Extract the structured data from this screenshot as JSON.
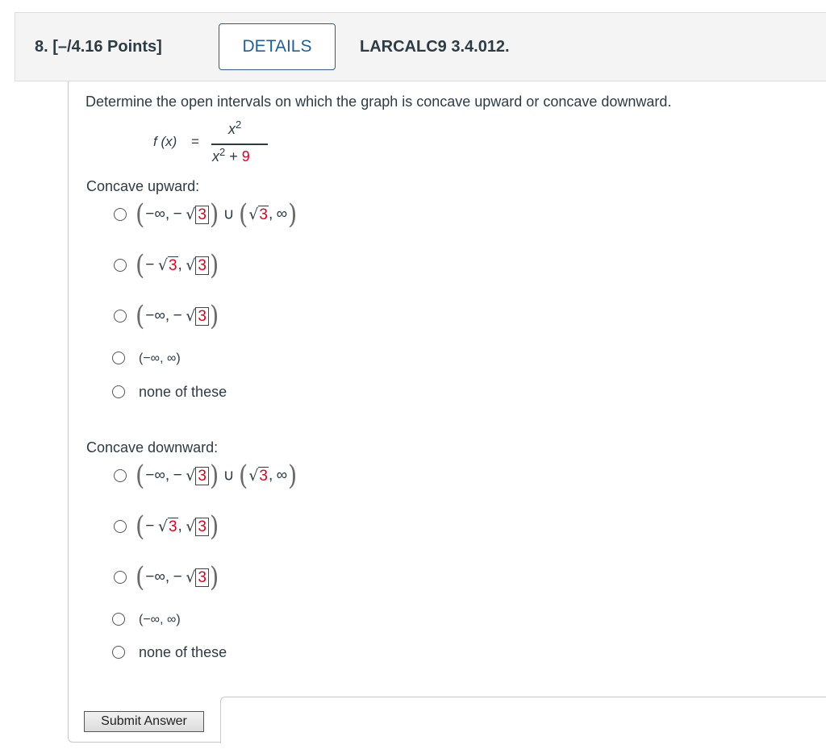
{
  "header": {
    "question_number": "8.  [–/4.16 Points]",
    "details_label": "DETAILS",
    "reference": "LARCALC9 3.4.012."
  },
  "problem": {
    "prompt": "Determine the open intervals on which the graph is concave upward or concave downward.",
    "function_label": "f (x)",
    "equals": "=",
    "numerator": "x",
    "numerator_exp": "2",
    "denominator_var": "x",
    "denominator_exp": "2",
    "denominator_rest": " + ",
    "denominator_const": "9"
  },
  "concave_upward": {
    "label": "Concave upward:",
    "options": [
      {
        "text": "(−∞, − √3) ∪ (√3, ∞)"
      },
      {
        "text": "(− √3, √3)"
      },
      {
        "text": "(−∞, − √3)"
      },
      {
        "text": "(−∞, ∞)"
      },
      {
        "text": "none of these"
      }
    ]
  },
  "concave_downward": {
    "label": "Concave downward:",
    "options": [
      {
        "text": "(−∞, − √3) ∪ (√3, ∞)"
      },
      {
        "text": "(− √3, √3)"
      },
      {
        "text": "(−∞, − √3)"
      },
      {
        "text": "(−∞, ∞)"
      },
      {
        "text": "none of these"
      }
    ]
  },
  "math_symbols": {
    "neg_inf": "−∞,",
    "minus": "−",
    "sqrt": "√",
    "three": "3",
    "comma": ",",
    "inf": "∞",
    "union": "∪",
    "lparen": "(",
    "rparen": ")"
  },
  "submit": {
    "label": "Submit Answer"
  },
  "colors": {
    "accent_red": "#e0001b",
    "details_blue": "#1f5f9a"
  }
}
